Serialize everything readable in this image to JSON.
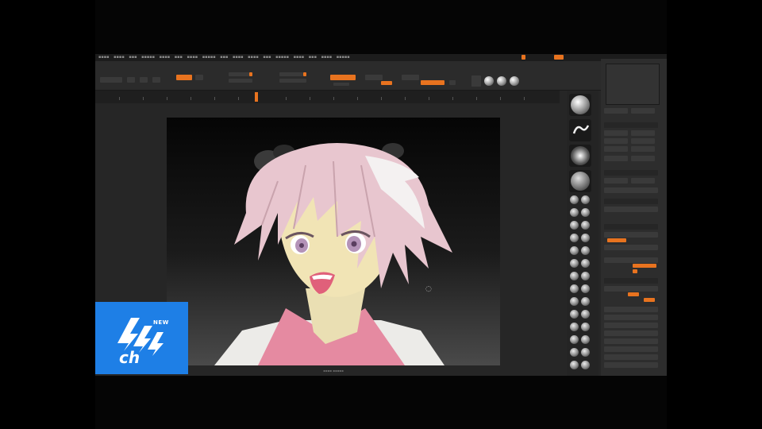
{
  "logo": {
    "badge": "NEW",
    "text": "ch"
  },
  "colors": {
    "accent": "#e8731f",
    "logo_blue": "#1e7fe6",
    "viewport_bg": "#0d0d0d",
    "ui_bg": "#262626"
  },
  "viewport": {
    "subject": "3D sculpt of anime character with pink hair and pink top",
    "cursor_icon": "rotate-cursor-icon"
  },
  "brush_shelf": {
    "icons": [
      "sphere-brush-icon",
      "stroke-icon",
      "alpha-icon",
      "texture-icon"
    ]
  }
}
